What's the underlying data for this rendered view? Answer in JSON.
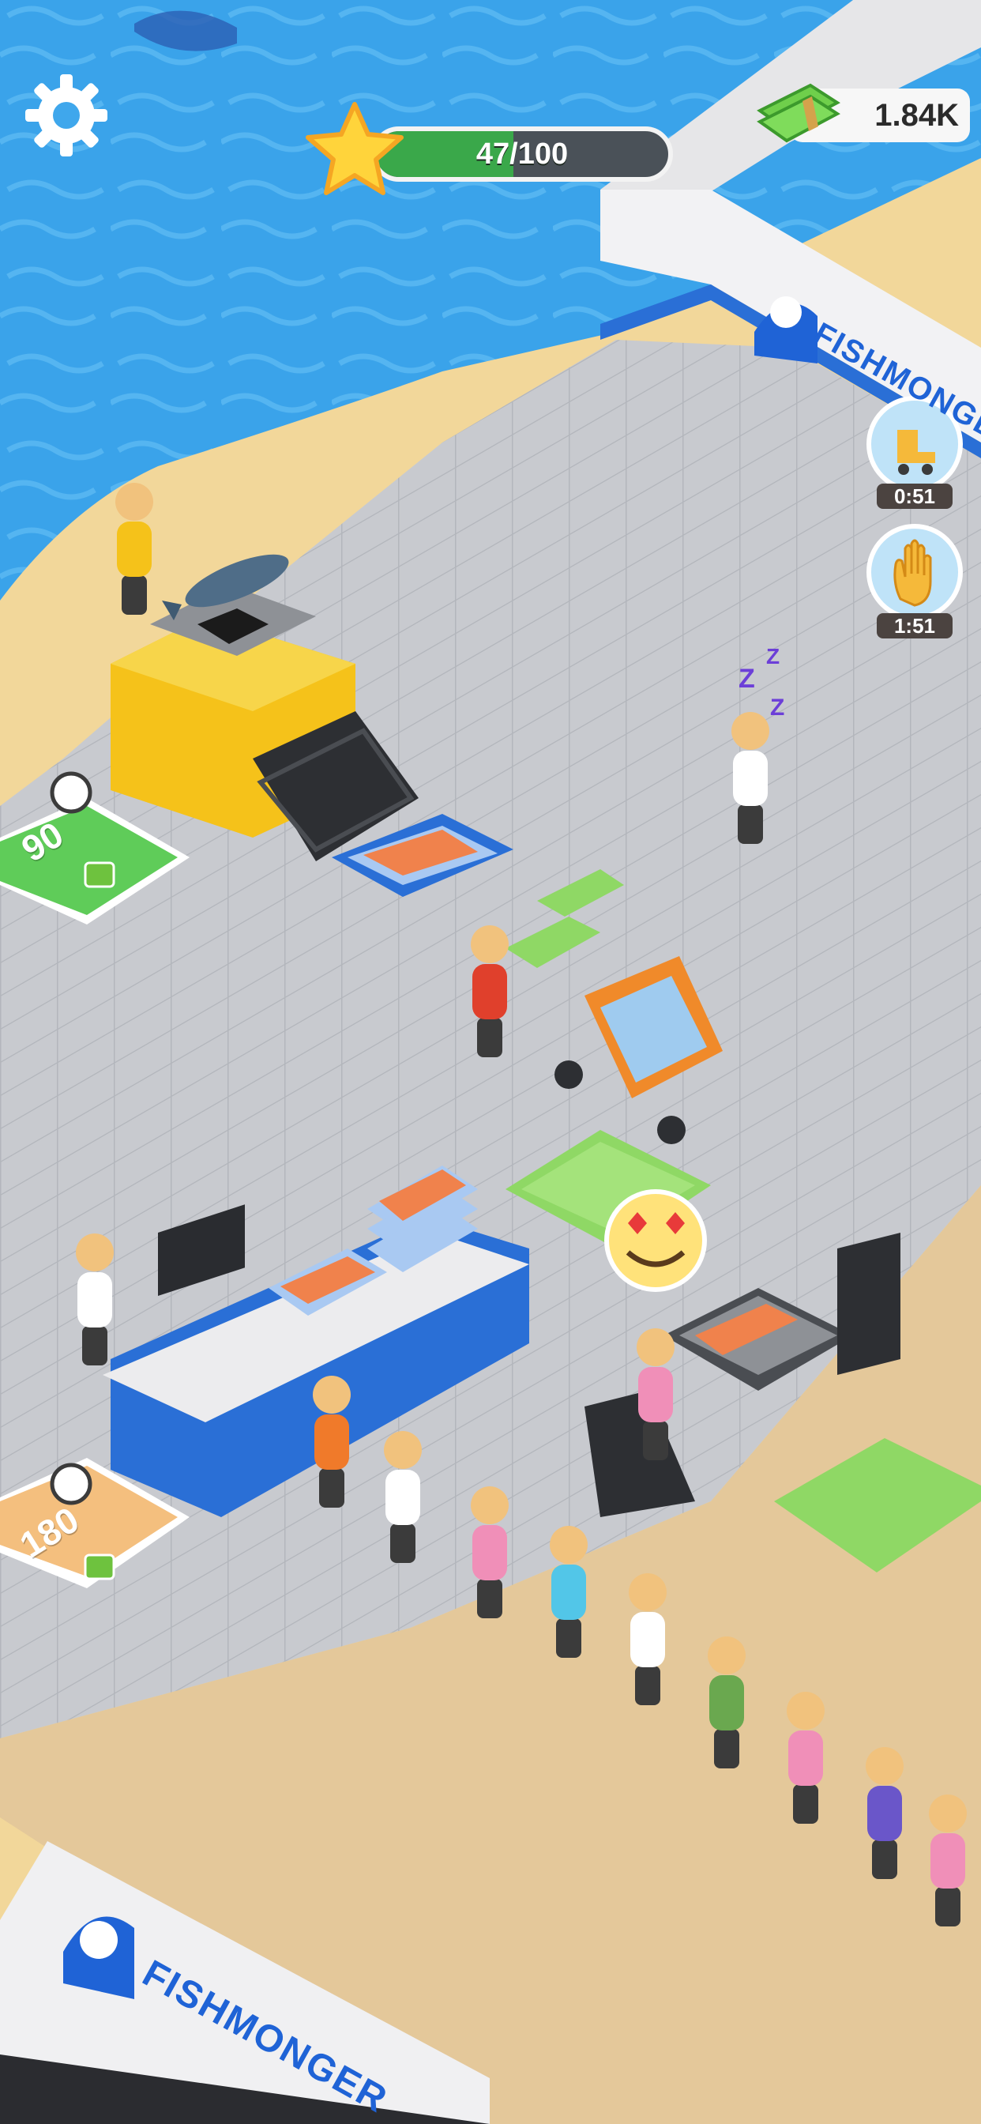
{
  "hud": {
    "level_progress": "47/100",
    "level_progress_value": 0.47,
    "cash": "1.84K",
    "settings_icon": "gear-icon",
    "star_icon": "star-icon",
    "cash_icon": "cash-stack-icon"
  },
  "boosts": [
    {
      "icon": "roller-skate-icon",
      "timer": "0:51"
    },
    {
      "icon": "hand-icon",
      "timer": "1:51"
    }
  ],
  "build_pads": [
    {
      "price": "90",
      "icon": "cash-icon"
    },
    {
      "price": "180",
      "icon": "cash-icon"
    }
  ],
  "signs": [
    {
      "text": "FISHMONGER"
    },
    {
      "text": "FISHMONGER"
    }
  ],
  "sleep_indicator": "zzz",
  "colors": {
    "sea": "#3fa7ec",
    "sand": "#f2d79a",
    "floor": "#c9cbd1",
    "counter_blue": "#2a6fd6",
    "machine_yellow": "#f5c21a",
    "progress_green": "#3aa84a"
  }
}
